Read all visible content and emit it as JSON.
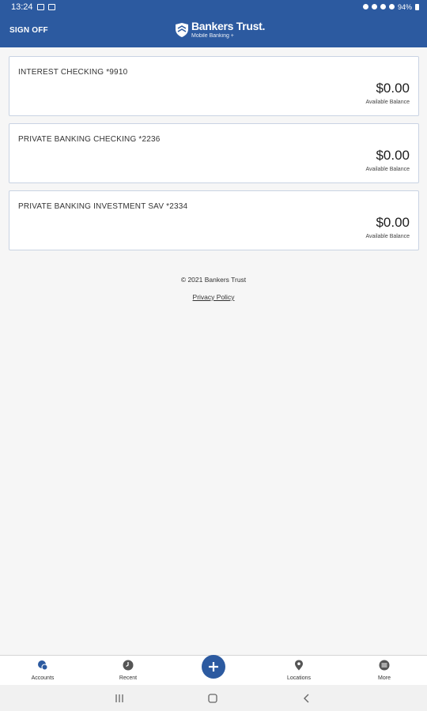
{
  "status_bar": {
    "time": "13:24",
    "battery": "94%"
  },
  "header": {
    "sign_off_label": "SIGN OFF",
    "brand_name": "Bankers Trust.",
    "brand_subtitle": "Mobile Banking +"
  },
  "accounts": [
    {
      "name": "INTEREST CHECKING *9910",
      "balance": "$0.00",
      "balance_label": "Available Balance"
    },
    {
      "name": "PRIVATE BANKING CHECKING *2236",
      "balance": "$0.00",
      "balance_label": "Available Balance"
    },
    {
      "name": "PRIVATE BANKING INVESTMENT SAV *2334",
      "balance": "$0.00",
      "balance_label": "Available Balance"
    }
  ],
  "footer": {
    "copyright": "© 2021 Bankers Trust",
    "privacy_link": "Privacy Policy"
  },
  "tab_bar": {
    "items": [
      {
        "label": "Accounts",
        "icon": "accounts-icon"
      },
      {
        "label": "Recent",
        "icon": "clock-icon"
      },
      {
        "label": "Locations",
        "icon": "map-pin-icon"
      },
      {
        "label": "More",
        "icon": "more-icon"
      }
    ],
    "add_icon": "plus-icon"
  },
  "colors": {
    "brand_blue": "#2c5aa0",
    "active_tab": "#2c5aa0",
    "inactive_tab": "#555555"
  }
}
